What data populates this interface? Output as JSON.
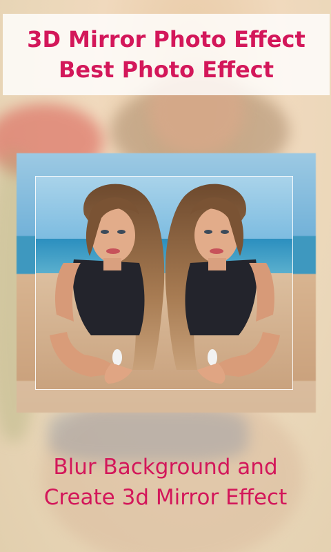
{
  "header": {
    "title_line1": "3D Mirror Photo Effect",
    "title_line2": "Best Photo Effect"
  },
  "caption": {
    "line1": "Blur Background and",
    "line2": "Create 3d Mirror Effect"
  },
  "colors": {
    "accent": "#d3175a",
    "header_bg": "#ffffff"
  },
  "images": {
    "background": "blurred-portrait-photo",
    "main": "mirrored-beach-portrait-photo"
  }
}
